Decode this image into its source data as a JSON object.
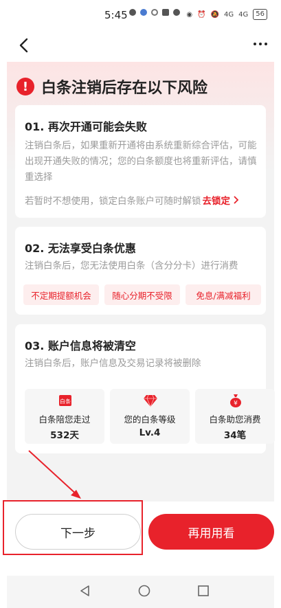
{
  "status_bar": {
    "time": "5:45",
    "signal_1": "4G",
    "signal_2": "4G",
    "battery": "56"
  },
  "nav": {
    "back": "back",
    "more": "more"
  },
  "risk": {
    "title": "白条注销后存在以下风险"
  },
  "card1": {
    "title": "01. 再次开通可能会失败",
    "desc": "注销白条后，如果重新开通将由系统重新综合评估，可能出现开通失败的情况；您的白条额度也将重新评估，请慎重选择",
    "lock_text": "若暂时不想使用，锁定白条账户可随时解锁",
    "lock_link": "去锁定"
  },
  "card2": {
    "title": "02. 无法享受白条优惠",
    "desc": "注销白条后，您无法使用白条（含分分卡）进行消费",
    "tags": [
      "不定期提额机会",
      "随心分期不受限",
      "免息/满减福利"
    ]
  },
  "card3": {
    "title": "03. 账户信息将被清空",
    "desc": "注销白条后，账户信息及交易记录将被删除",
    "stats": [
      {
        "icon": "baitiao-card-icon",
        "icon_text": "白条",
        "label": "白条陪您走过",
        "value": "532天"
      },
      {
        "icon": "diamond-icon",
        "label": "您的白条等级",
        "value": "Lv.4"
      },
      {
        "icon": "money-bag-icon",
        "icon_text": "¥",
        "label": "白条助您消费",
        "value": "34笔"
      }
    ]
  },
  "buttons": {
    "next": "下一步",
    "retry": "再用用看"
  },
  "colors": {
    "accent": "#e8222b",
    "tag_bg": "#fdeeee",
    "header_gradient": "#fde4e4"
  }
}
